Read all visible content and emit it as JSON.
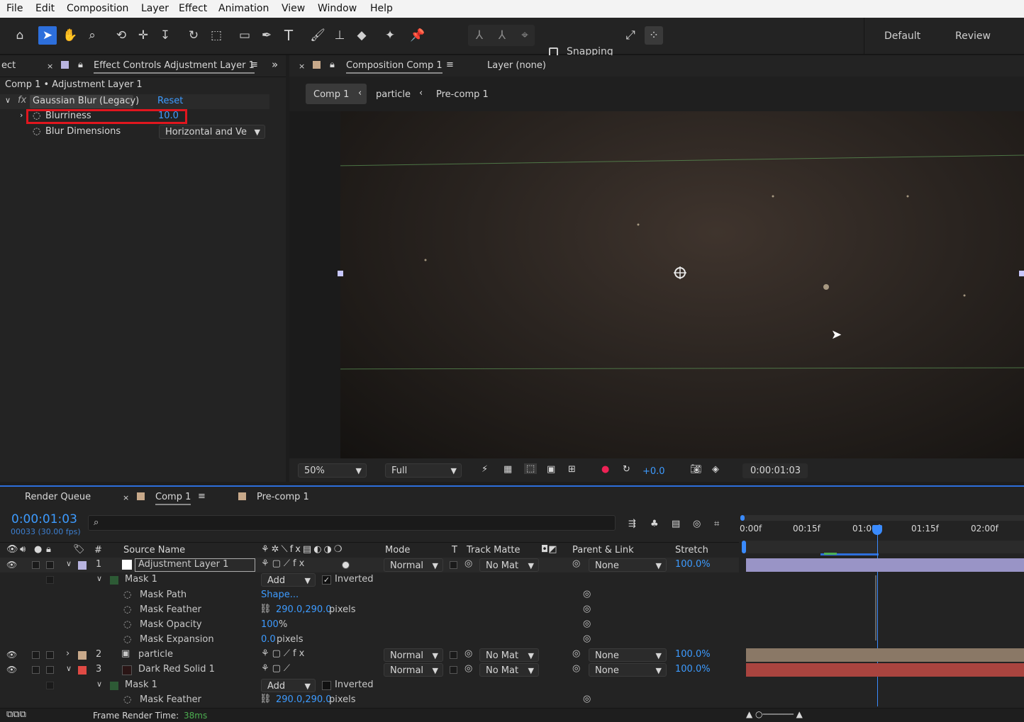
{
  "menu": [
    "File",
    "Edit",
    "Composition",
    "Layer",
    "Effect",
    "Animation",
    "View",
    "Window",
    "Help"
  ],
  "toolbar": {
    "snapping_label": "Snapping",
    "workspaces": [
      "Default",
      "Review"
    ]
  },
  "effect_panel": {
    "left_tab": "ect",
    "tab_title": "Effect Controls Adjustment Layer 1",
    "breadcrumb": "Comp 1 • Adjustment Layer 1",
    "effect_name": "Gaussian Blur (Legacy)",
    "reset_label": "Reset",
    "fx_label": "fx",
    "props": [
      {
        "name": "Blurriness",
        "value": "10.0"
      },
      {
        "name": "Blur Dimensions",
        "value": "Horizontal and Ve"
      }
    ]
  },
  "comp_panel": {
    "tab_title": "Composition Comp 1",
    "layer_tab": "Layer (none)",
    "breadcrumbs": [
      "Comp 1",
      "particle",
      "Pre-comp 1"
    ],
    "zoom": "50%",
    "resolution": "Full",
    "exposure": "+0.0",
    "timecode": "0:00:01:03"
  },
  "timeline": {
    "tabs": [
      "Render Queue",
      "Comp 1",
      "Pre-comp 1"
    ],
    "current_time": "0:00:01:03",
    "frame_info": "00033 (30.00 fps)",
    "search_placeholder": "",
    "columns": {
      "num": "#",
      "source": "Source Name",
      "mode": "Mode",
      "t": "T",
      "matte": "Track Matte",
      "parent": "Parent & Link",
      "stretch": "Stretch"
    },
    "ruler": [
      "0:00f",
      "00:15f",
      "01:00f",
      "01:15f",
      "02:00f"
    ],
    "layers": [
      {
        "num": "1",
        "name": "Adjustment Layer 1",
        "mode": "Normal",
        "matte": "No Mat",
        "parent": "None",
        "stretch": "100.0%",
        "color": "#b8b4e0"
      },
      {
        "num": "2",
        "name": "particle",
        "mode": "Normal",
        "matte": "No Mat",
        "parent": "None",
        "stretch": "100.0%",
        "color": "#c8a98a"
      },
      {
        "num": "3",
        "name": "Dark Red Solid 1",
        "mode": "Normal",
        "matte": "No Mat",
        "parent": "None",
        "stretch": "100.0%",
        "color": "#e04a44"
      }
    ],
    "mask1": {
      "name": "Mask 1",
      "mode": "Add",
      "inverted": "Inverted",
      "path_label": "Mask Path",
      "path_value": "Shape...",
      "feather_label": "Mask Feather",
      "feather_value": "290.0,290.0",
      "feather_unit": "pixels",
      "opacity_label": "Mask Opacity",
      "opacity_value": "100",
      "opacity_unit": "%",
      "expansion_label": "Mask Expansion",
      "expansion_value": "0.0",
      "expansion_unit": "pixels"
    },
    "mask3": {
      "name": "Mask 1",
      "mode": "Add",
      "inverted": "Inverted",
      "feather_label": "Mask Feather",
      "feather_value": "290.0,290.0",
      "feather_unit": "pixels"
    },
    "footer_label": "Frame Render Time:",
    "footer_value": "38ms"
  }
}
